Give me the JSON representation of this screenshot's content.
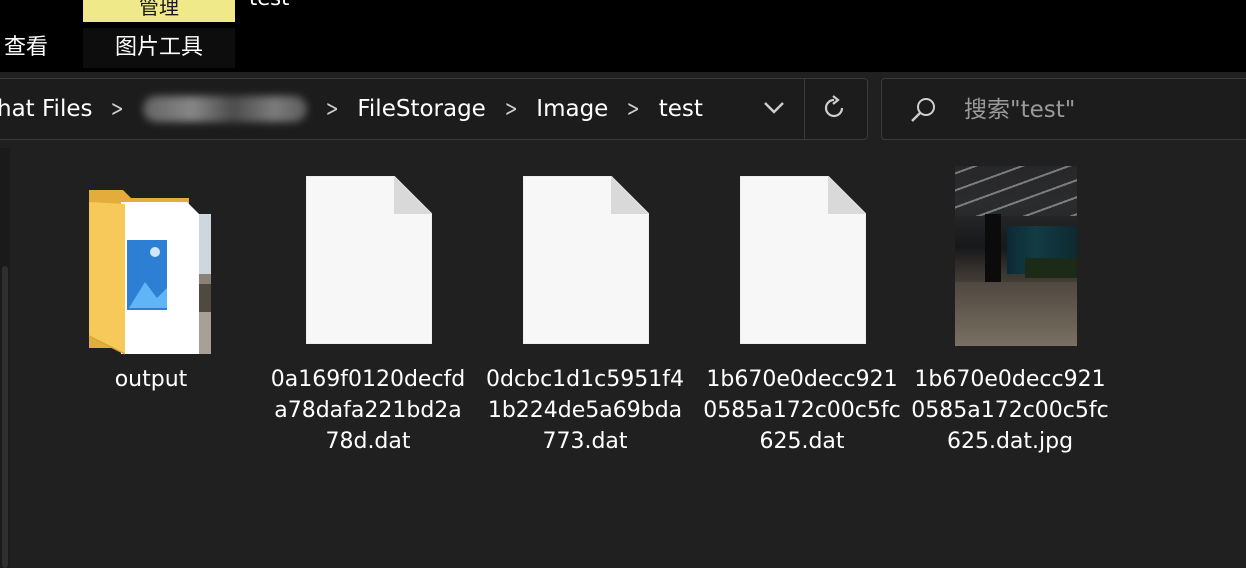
{
  "ribbon": {
    "context_tab_label": "管理",
    "window_title": "test",
    "tabs": [
      "查看",
      "图片工具"
    ]
  },
  "address": {
    "breadcrumbs": [
      "hat Files",
      "",
      "FileStorage",
      "Image",
      "test"
    ]
  },
  "search": {
    "placeholder": "搜索\"test\""
  },
  "files": [
    {
      "name": "output",
      "type": "folder"
    },
    {
      "name": "0a169f0120decfda78dafa221bd2a78d.dat",
      "type": "file"
    },
    {
      "name": "0dcbc1d1c5951f41b224de5a69bda773.dat",
      "type": "file"
    },
    {
      "name": "1b670e0decc9210585a172c00c5fc625.dat",
      "type": "file"
    },
    {
      "name": "1b670e0decc9210585a172c00c5fc625.dat.jpg",
      "type": "image"
    }
  ],
  "colors": {
    "background": "#202020",
    "ribbon": "#000000",
    "context_tab": "#efe98a"
  },
  "icons": [
    "chevron-right-icon",
    "chevron-down-icon",
    "refresh-icon",
    "search-icon",
    "folder-icon",
    "document-icon"
  ]
}
